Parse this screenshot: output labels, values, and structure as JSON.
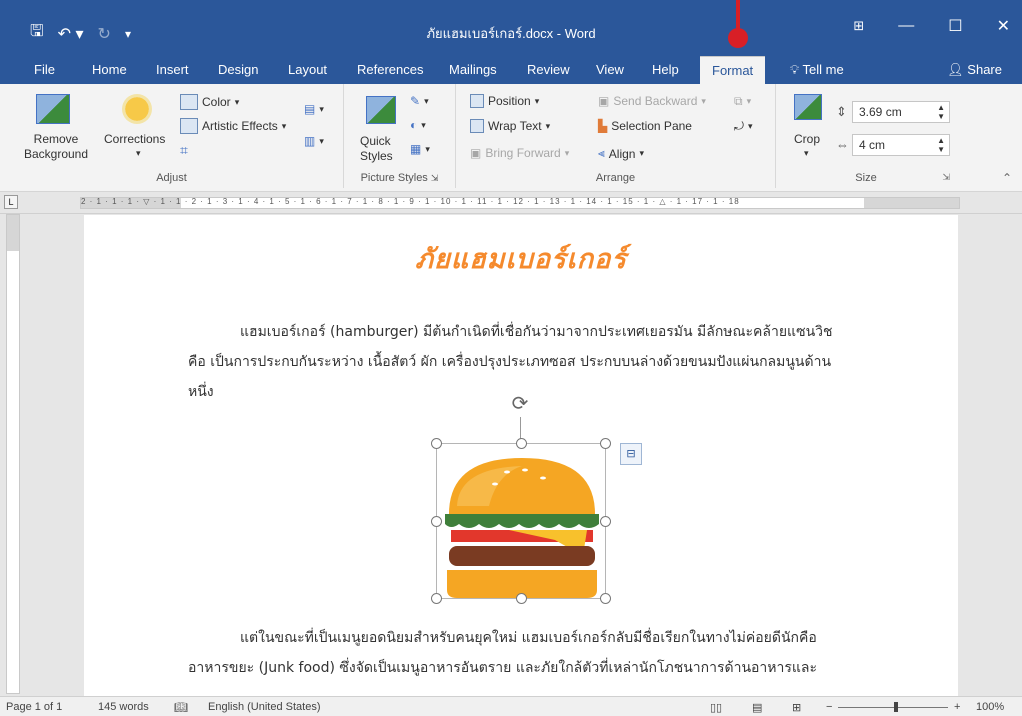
{
  "titlebar": {
    "document_title": "ภัยแฮมเบอร์เกอร์.docx - Word",
    "qat": {
      "save_icon": "save-icon",
      "undo_icon": "undo-icon",
      "redo_icon": "redo-icon",
      "customize_icon": "customize-qat-icon"
    },
    "ribbon_display_icon": "ribbon-display-options-icon",
    "minimize_glyph": "—",
    "maximize_glyph": "☐",
    "close_glyph": "✕"
  },
  "tabs": [
    "File",
    "Home",
    "Insert",
    "Design",
    "Layout",
    "References",
    "Mailings",
    "Review",
    "View",
    "Help",
    "Format"
  ],
  "active_tab": "Format",
  "tellme": "Tell me",
  "share": "Share",
  "ribbon": {
    "adjust": {
      "remove_background": "Remove Background",
      "corrections": "Corrections",
      "color": "Color",
      "artistic_effects": "Artistic Effects",
      "label": "Adjust"
    },
    "picture_styles": {
      "quick_styles": "Quick Styles",
      "label": "Picture Styles"
    },
    "arrange": {
      "position": "Position",
      "wrap_text": "Wrap Text",
      "bring_forward": "Bring Forward",
      "send_backward": "Send Backward",
      "selection_pane": "Selection Pane",
      "align": "Align",
      "label": "Arrange"
    },
    "size": {
      "crop": "Crop",
      "height": "3.69 cm",
      "width": "4 cm",
      "label": "Size"
    }
  },
  "ruler": {
    "numbers": "2 · 1 · 1 · 1 · ▽ · 1 · 1 · 2 · 1 · 3 · 1 · 4 · 1 · 5 · 1 · 6 · 1 · 7 · 1 · 8 · 1 · 9 · 1 · 10 · 1 · 11 · 1 · 12 · 1 · 13 · 1 · 14 · 1 · 15 · 1 · △ · 1 · 17 · 1 · 18"
  },
  "document": {
    "heading": "ภัยแฮมเบอร์เกอร์",
    "paragraph1": "แฮมเบอร์เกอร์ (hamburger) มีต้นกำเนิดที่เชื่อกันว่ามาจากประเทศเยอรมัน มีลักษณะคล้ายแซนวิช คือ เป็นการประกบกันระหว่าง เนื้อสัตว์ ผัก เครื่องปรุงประเภทซอส ประกบบนล่างด้วยขนมปังแผ่นกลมนูนด้านหนึ่ง",
    "paragraph2": "แต่ในขณะที่เป็นเมนูยอดนิยมสำหรับคนยุคใหม่ แฮมเบอร์เกอร์กลับมีชื่อเรียกในทางไม่ค่อยดีนักคือ อาหารขยะ (Junk food) ซึ่งจัดเป็นเมนูอาหารอันตราย และภัยใกล้ตัวที่เหล่านักโภชนาการด้านอาหารและ"
  },
  "statusbar": {
    "page": "Page 1 of 1",
    "words": "145 words",
    "language": "English (United States)",
    "zoom": "100%"
  },
  "colors": {
    "brand": "#2b579a",
    "heading": "#f58a2d",
    "marker": "#d81f26"
  }
}
